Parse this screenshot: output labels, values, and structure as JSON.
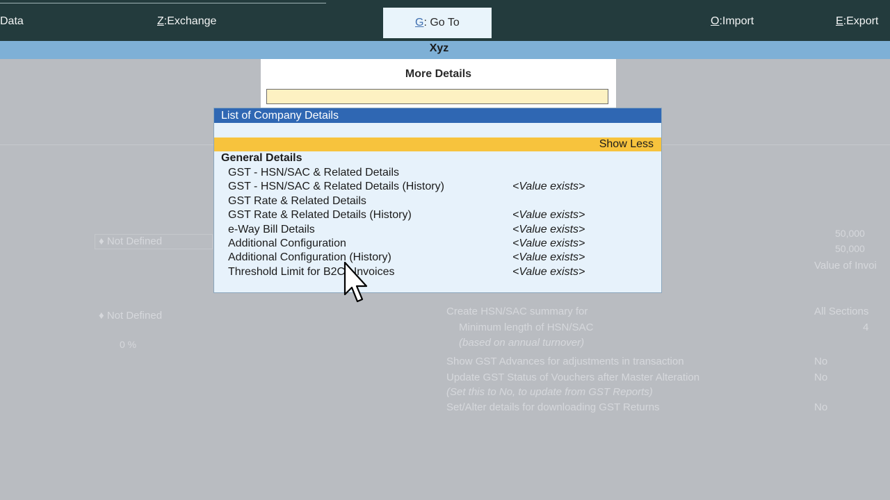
{
  "topbar": {
    "data_label": "Data",
    "exchange": {
      "key": "Z",
      "label": "Exchange"
    },
    "goto": {
      "key": "G",
      "label": "Go To"
    },
    "import": {
      "key": "O",
      "label": "Import"
    },
    "export": {
      "key": "E",
      "label": "Export"
    }
  },
  "company": {
    "name": "Xyz"
  },
  "more_details": {
    "title": "More Details",
    "input_value": ""
  },
  "list": {
    "title": "List of Company Details",
    "show_less": "Show Less",
    "section": "General Details",
    "items": [
      {
        "label": "GST - HSN/SAC & Related Details",
        "value": ""
      },
      {
        "label": "GST - HSN/SAC & Related Details (History)",
        "value": "<Value exists>"
      },
      {
        "label": "GST Rate & Related Details",
        "value": ""
      },
      {
        "label": "GST Rate & Related Details (History)",
        "value": "<Value exists>"
      },
      {
        "label": "e-Way Bill Details",
        "value": "<Value exists>"
      },
      {
        "label": "Additional Configuration",
        "value": "<Value exists>"
      },
      {
        "label": "Additional Configuration (History)",
        "value": "<Value exists>"
      },
      {
        "label": "Threshold Limit for B2CL Invoices",
        "value": "<Value exists>"
      }
    ]
  },
  "background": {
    "not_defined_1": "Not Defined",
    "not_defined_2": "Not Defined",
    "percent": "0 %",
    "amount_1": "50,000",
    "amount_2": "50,000",
    "value_of_invoice": "Value of Invoi",
    "create_hsn": "Create HSN/SAC summary for",
    "create_hsn_value": "All Sections",
    "min_length": "Minimum length of HSN/SAC",
    "min_length_value": "4",
    "based_on": "(based on annual turnover)",
    "show_gst_adv": "Show GST Advances for adjustments in transaction",
    "show_gst_adv_value": "No",
    "update_gst": "Update GST Status of Vouchers after Master Alteration",
    "update_gst_value": "No",
    "set_this": "(Set this to No, to update from GST Reports)",
    "set_alter": "Set/Alter details for downloading GST Returns",
    "set_alter_value": "No"
  },
  "colors": {
    "topbar": "#233b3d",
    "company_bar": "#7eb0d6",
    "list_header": "#2f67b3",
    "show_less": "#f7c33d",
    "popup_bg": "#e7f2fb"
  }
}
